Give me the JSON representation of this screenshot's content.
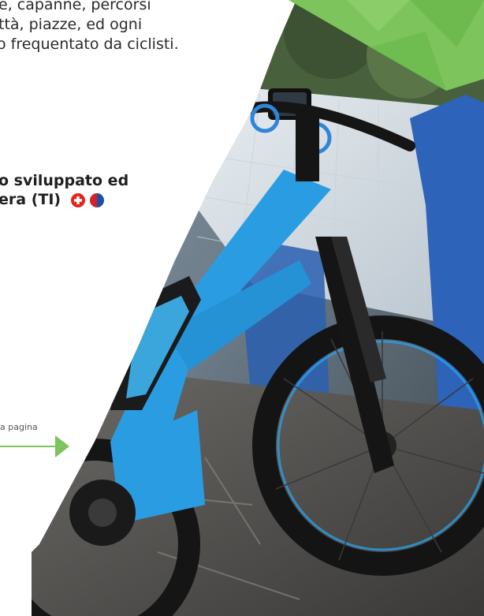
{
  "intro": {
    "line1": "e, capanne, percorsi",
    "line2": "ttà, piazze, ed ogni",
    "line3": "o frequentato da ciclisti."
  },
  "headline": {
    "line1": "o sviluppato ed",
    "line2": "era (TI)"
  },
  "link": {
    "label": "a pagina"
  },
  "colors": {
    "accent_green": "#7cc45b",
    "swiss_red": "#e2261f",
    "ticino_red": "#d2232a",
    "ticino_blue": "#1f4fa3",
    "bike_blue": "#2a9de2"
  }
}
